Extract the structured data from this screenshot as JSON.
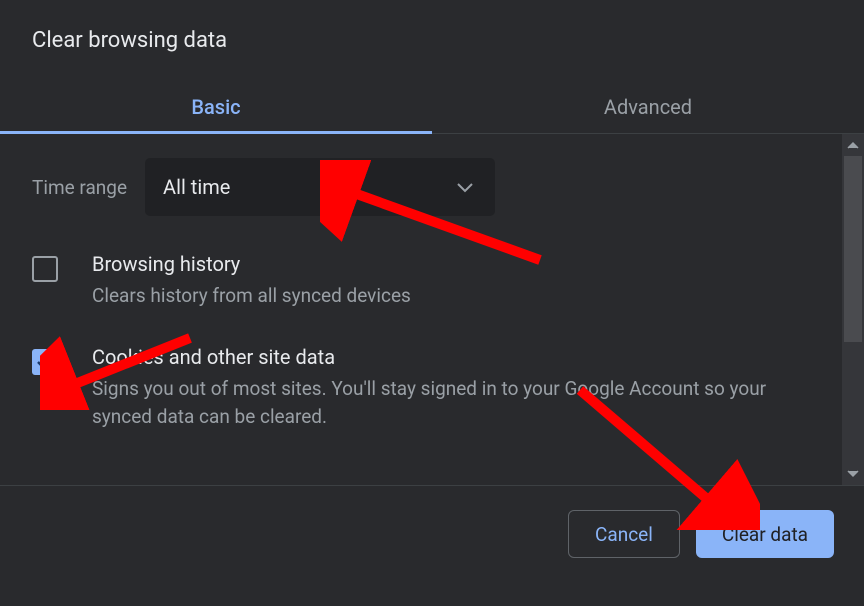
{
  "dialog": {
    "title": "Clear browsing data"
  },
  "tabs": {
    "basic": "Basic",
    "advanced": "Advanced"
  },
  "timeRange": {
    "label": "Time range",
    "value": "All time"
  },
  "options": {
    "browsingHistory": {
      "title": "Browsing history",
      "desc": "Clears history from all synced devices",
      "checked": false
    },
    "cookies": {
      "title": "Cookies and other site data",
      "desc": "Signs you out of most sites. You'll stay signed in to your Google Account so your synced data can be cleared.",
      "checked": true
    }
  },
  "buttons": {
    "cancel": "Cancel",
    "clear": "Clear data"
  }
}
